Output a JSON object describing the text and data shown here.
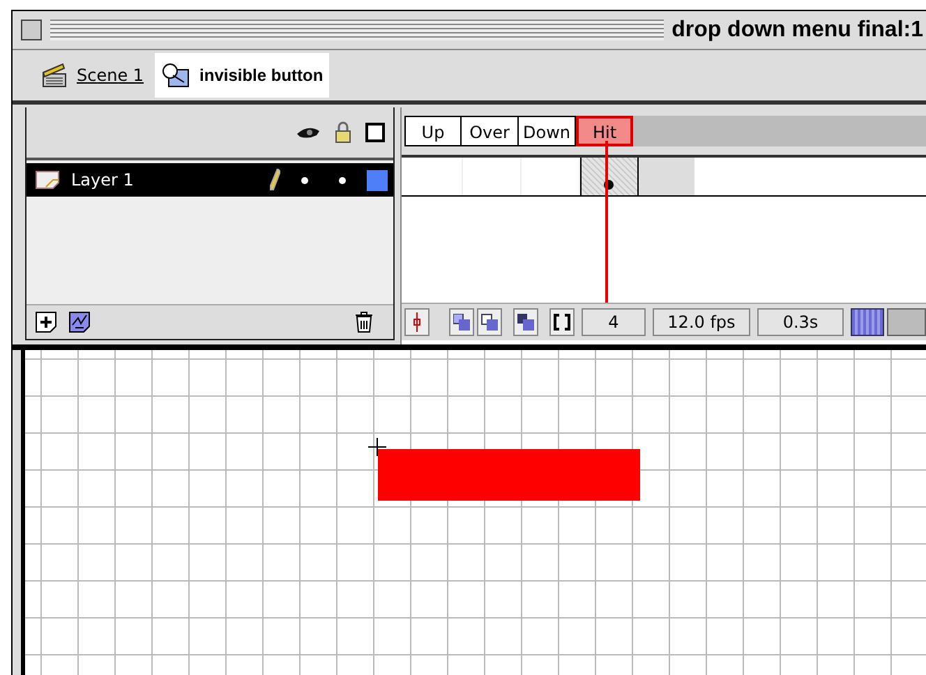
{
  "window": {
    "title": "drop down menu final:1"
  },
  "breadcrumbs": [
    {
      "label": "Scene 1",
      "kind": "scene",
      "selected": false
    },
    {
      "label": "invisible button",
      "kind": "symbol",
      "selected": true
    }
  ],
  "layers": [
    {
      "name": "Layer 1",
      "selected": true,
      "color": "#4f7ef8"
    }
  ],
  "frame_labels": [
    {
      "label": "Up",
      "selected": false
    },
    {
      "label": "Over",
      "selected": false
    },
    {
      "label": "Down",
      "selected": false
    },
    {
      "label": "Hit",
      "selected": true
    }
  ],
  "frames": [
    {
      "keyframe": false
    },
    {
      "keyframe": false
    },
    {
      "keyframe": false
    },
    {
      "keyframe": true
    }
  ],
  "status": {
    "current_frame": "4",
    "frame_rate": "12.0 fps",
    "elapsed_time": "0.3s"
  }
}
